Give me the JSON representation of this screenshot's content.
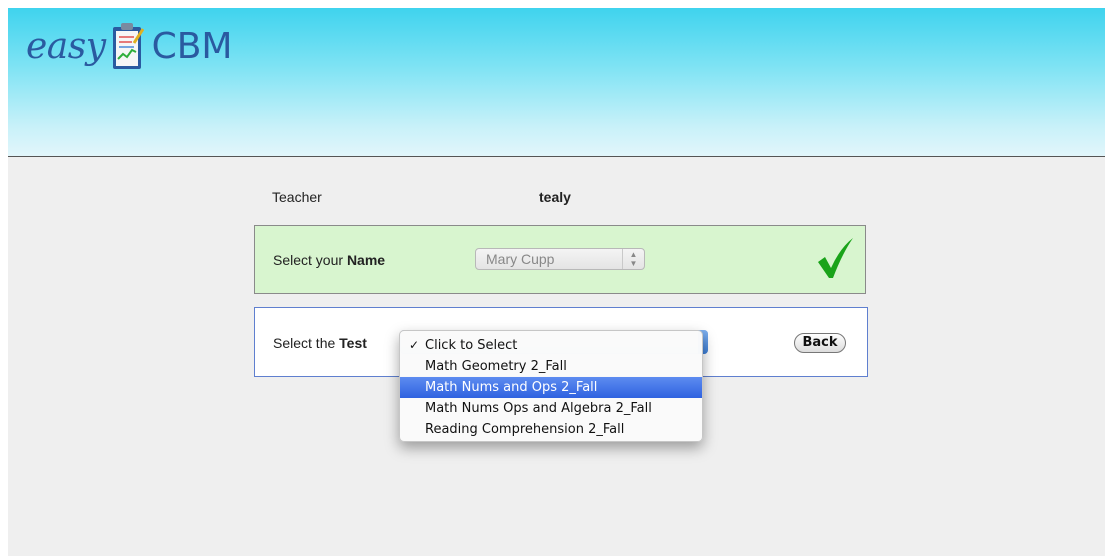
{
  "logo": {
    "easy": "easy",
    "cbm": "CBM"
  },
  "teacher": {
    "label": "Teacher",
    "value": "tealy"
  },
  "name_section": {
    "label_prefix": "Select your ",
    "label_bold": "Name",
    "selected_value": "Mary Cupp",
    "status_icon": "green-checkmark-icon",
    "status_color": "#1aa31a",
    "background": "#d8f5cf"
  },
  "test_section": {
    "label_prefix": "Select the ",
    "label_bold": "Test",
    "back_label": "Back",
    "border_color": "#5f7fcf"
  },
  "dropdown": {
    "options": [
      {
        "label": "Click to Select",
        "checked": true,
        "highlighted": false
      },
      {
        "label": "Math Geometry 2_Fall",
        "checked": false,
        "highlighted": false
      },
      {
        "label": "Math Nums and Ops 2_Fall",
        "checked": false,
        "highlighted": true
      },
      {
        "label": "Math Nums Ops and Algebra 2_Fall",
        "checked": false,
        "highlighted": false
      },
      {
        "label": "Reading Comprehension 2_Fall",
        "checked": false,
        "highlighted": false
      }
    ],
    "check_glyph": "✓",
    "highlight_color": "#3b6fe6"
  },
  "colors": {
    "header_top": "#3fd3ee",
    "page_bg": "#efefef",
    "brand_blue": "#2a5aa0"
  }
}
